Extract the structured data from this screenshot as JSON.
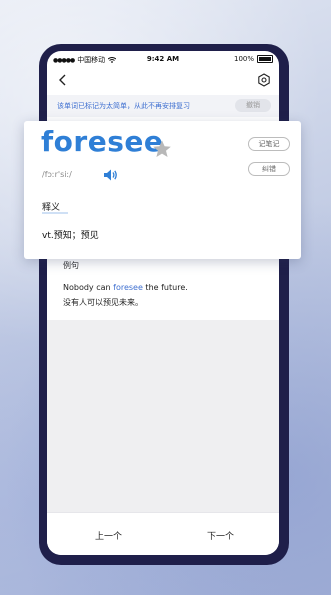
{
  "status_bar": {
    "carrier": "中国移动",
    "time": "9:42 AM",
    "battery": "100%"
  },
  "notice": {
    "text": "该单词已标记为太简单，从此不再安排复习",
    "undo_label": "撤销"
  },
  "word_card": {
    "word": "foresee",
    "phonetic": "/fɔːr'siː/",
    "note_label": "记笔记",
    "report_label": "纠错",
    "definition_label": "释义",
    "definition": "vt.预知；预见"
  },
  "example": {
    "label": "例句",
    "sentence_before": "Nobody can ",
    "sentence_highlight": "foresee",
    "sentence_after": " the future.",
    "translation": "没有人可以预见未来。"
  },
  "bottom_nav": {
    "prev_label": "上一个",
    "next_label": "下一个"
  },
  "colors": {
    "accent": "#2f7fd6",
    "notice_text": "#3e6fd0",
    "phone_frame": "#1f1f4a"
  },
  "icons": [
    "back-arrow-icon",
    "settings-icon",
    "star-icon",
    "speaker-icon",
    "signal-icon",
    "wifi-icon",
    "battery-icon"
  ]
}
